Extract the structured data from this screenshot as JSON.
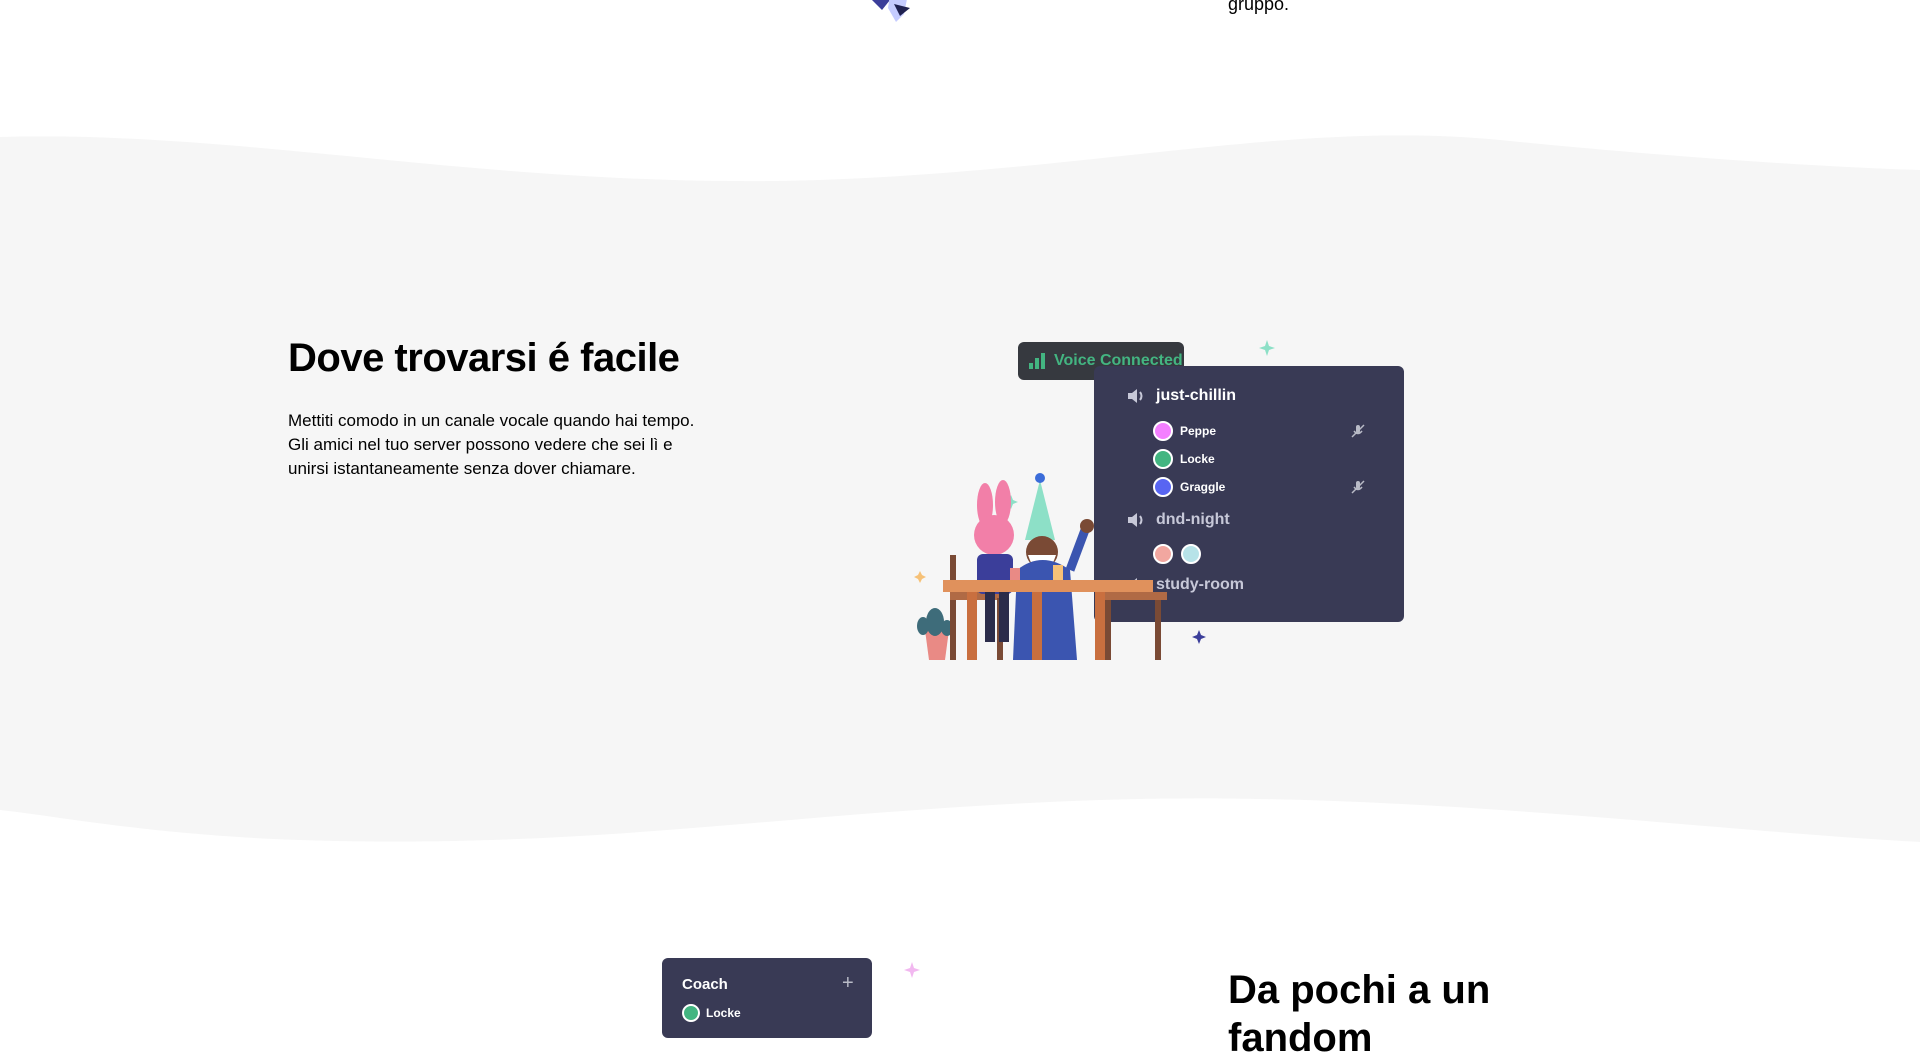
{
  "top": {
    "text": "gruppo."
  },
  "section": {
    "title": "Dove trovarsi é facile",
    "description": "Mettiti comodo in un canale vocale quando hai tempo. Gli amici nel tuo server possono vedere che sei lì e unirsi istantaneamente senza dover chiamare."
  },
  "voice_badge": {
    "label": "Voice Connected"
  },
  "channels": [
    {
      "name": "just-chillin"
    },
    {
      "name": "dnd-night"
    },
    {
      "name": "study-room"
    }
  ],
  "users": [
    {
      "name": "Peppe",
      "muted": true,
      "color": "#f47fff"
    },
    {
      "name": "Locke",
      "muted": false,
      "color": "#43b581"
    },
    {
      "name": "Graggle",
      "muted": true,
      "color": "#5865f2"
    }
  ],
  "bottom": {
    "card_title": "Coach",
    "card_user": "Locke",
    "title": "Da pochi a un fandom"
  },
  "colors": {
    "band": "#f6f6f6",
    "panel": "#393a55",
    "badge": "#36393f",
    "green": "#43b581"
  }
}
